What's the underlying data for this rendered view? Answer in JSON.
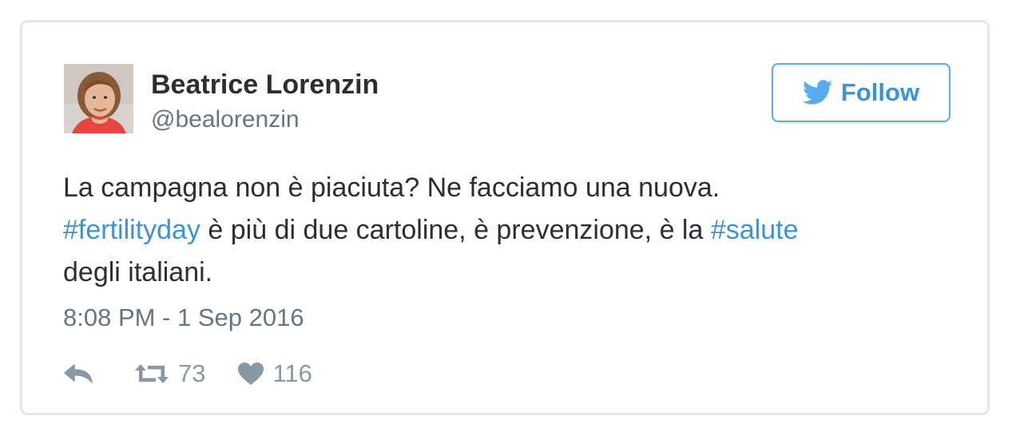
{
  "author": {
    "name": "Beatrice Lorenzin",
    "handle": "@bealorenzin"
  },
  "follow_button": {
    "label": "Follow",
    "icon": "twitter-bird-icon"
  },
  "tweet": {
    "line1": "La campagna non è piaciuta? Ne facciamo una nuova.",
    "hashtag1": "#fertilityday",
    "line2_middle": " è più di due cartoline, è prevenzione, è la ",
    "hashtag2": "#salute",
    "line3": "degli italiani."
  },
  "timestamp": "8:08 PM - 1 Sep 2016",
  "actions": {
    "reply_icon": "reply-icon",
    "retweet_icon": "retweet-icon",
    "retweet_count": "73",
    "like_icon": "heart-icon",
    "like_count": "116"
  },
  "colors": {
    "link": "#3b94d9",
    "text": "#292f33",
    "muted": "#66757f",
    "icon": "#8899a6",
    "border": "#e1e8ed",
    "follow_border": "#55acee"
  }
}
